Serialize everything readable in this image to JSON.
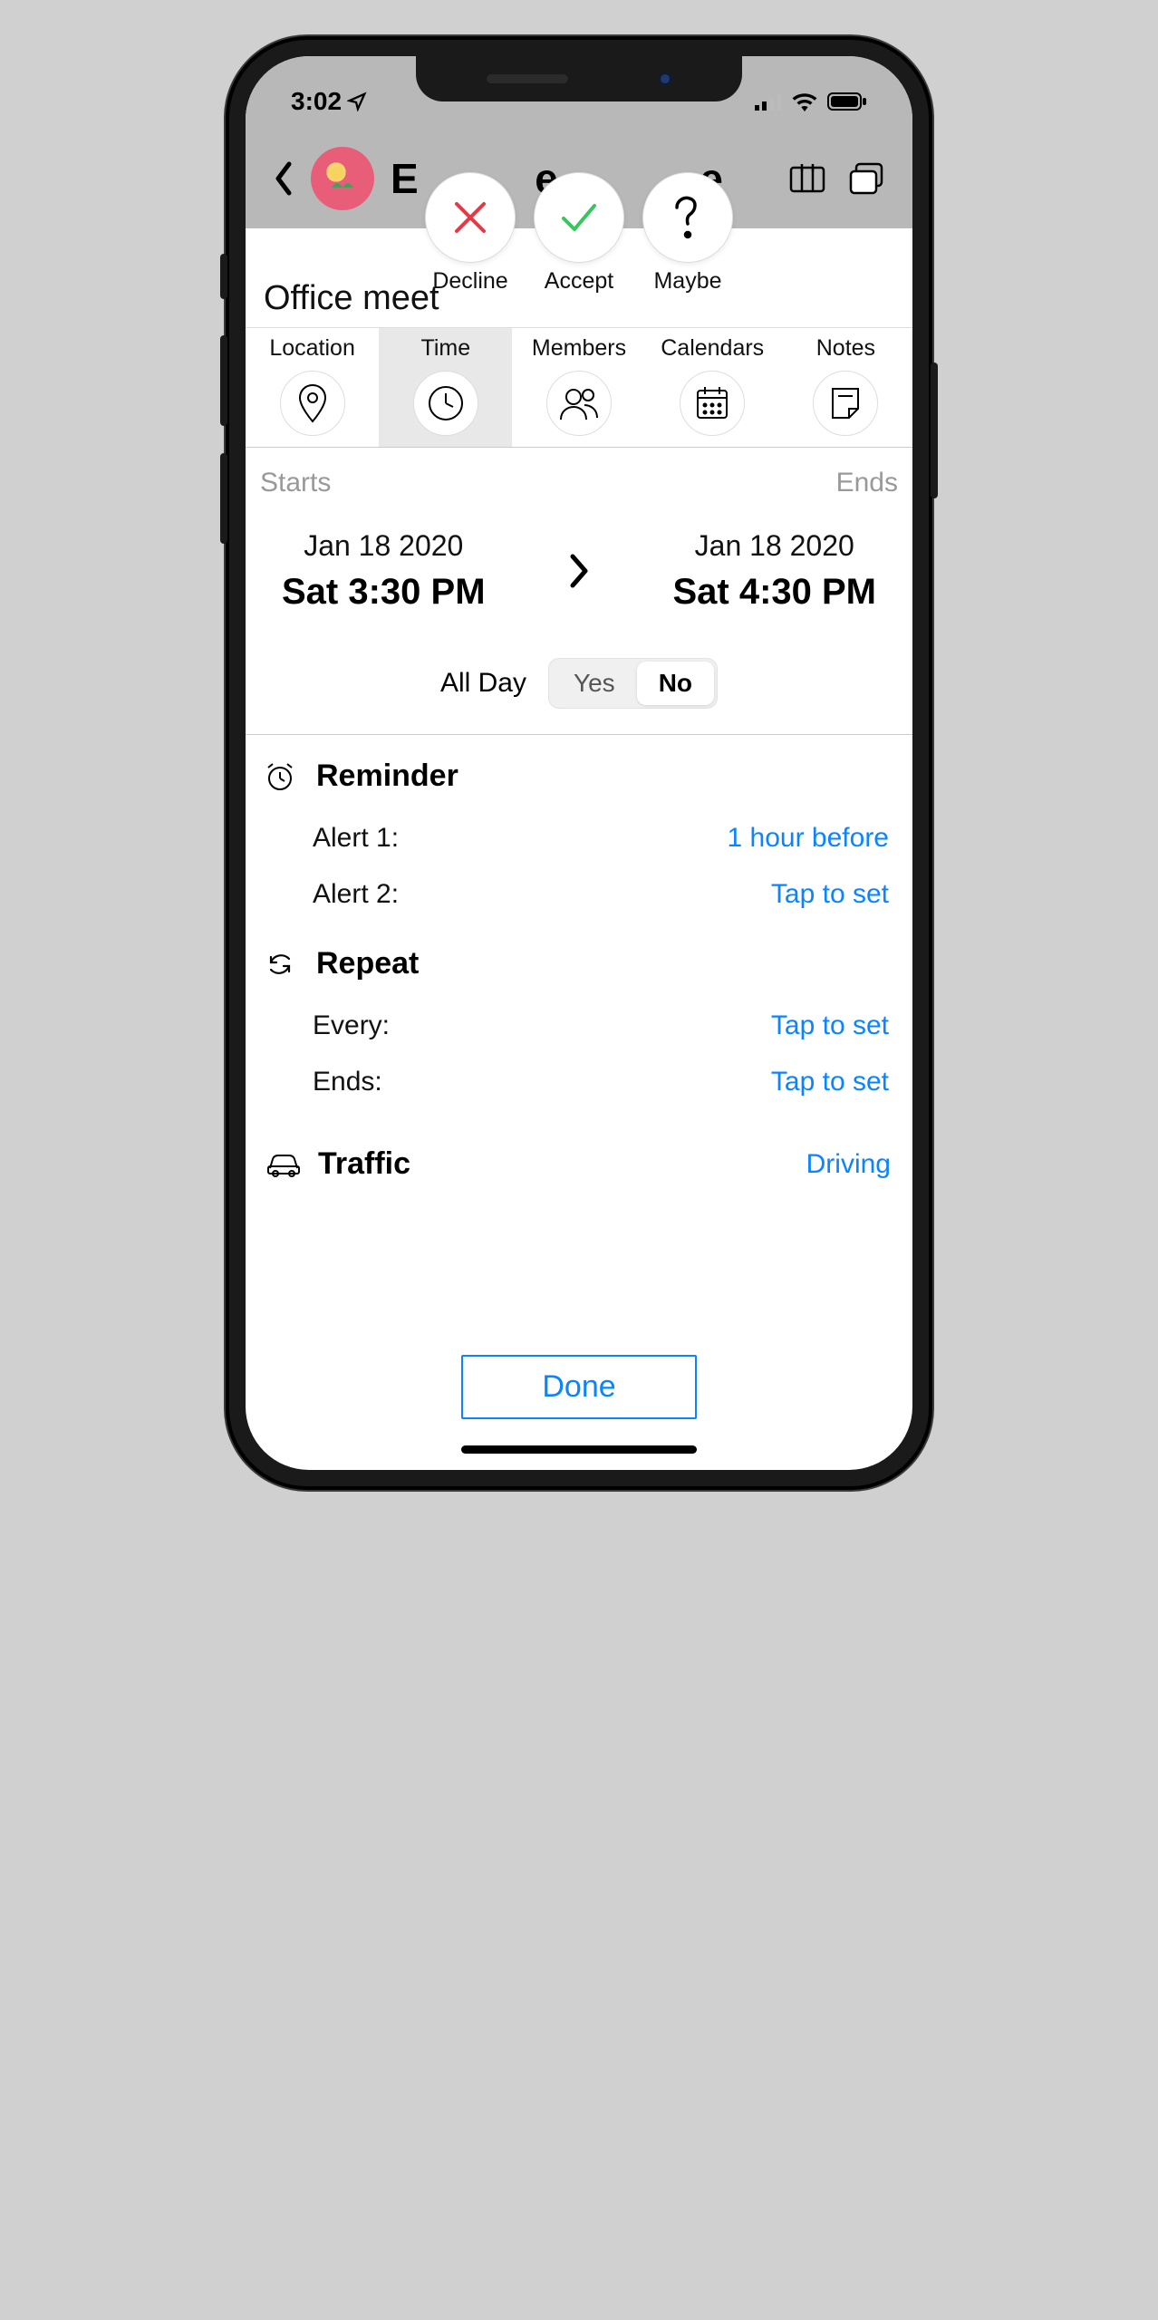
{
  "status": {
    "time": "3:02"
  },
  "rsvp": {
    "decline": "Decline",
    "accept": "Accept",
    "maybe": "Maybe"
  },
  "event": {
    "title": "Office meet"
  },
  "tabs": {
    "location": "Location",
    "time": "Time",
    "members": "Members",
    "calendars": "Calendars",
    "notes": "Notes",
    "active": "time"
  },
  "time_section": {
    "starts_label": "Starts",
    "ends_label": "Ends",
    "start_date": "Jan 18 2020",
    "start_daytime": "Sat 3:30 PM",
    "end_date": "Jan 18 2020",
    "end_daytime": "Sat 4:30 PM",
    "allday_label": "All Day",
    "allday_yes": "Yes",
    "allday_no": "No",
    "allday_value": "No"
  },
  "reminder": {
    "header": "Reminder",
    "alert1_label": "Alert 1:",
    "alert1_value": "1 hour before",
    "alert2_label": "Alert 2:",
    "alert2_value": "Tap to set"
  },
  "repeat": {
    "header": "Repeat",
    "every_label": "Every:",
    "every_value": "Tap to set",
    "ends_label": "Ends:",
    "ends_value": "Tap to set"
  },
  "traffic": {
    "header": "Traffic",
    "value": "Driving"
  },
  "done": "Done",
  "colors": {
    "accent": "#0a84ff"
  }
}
